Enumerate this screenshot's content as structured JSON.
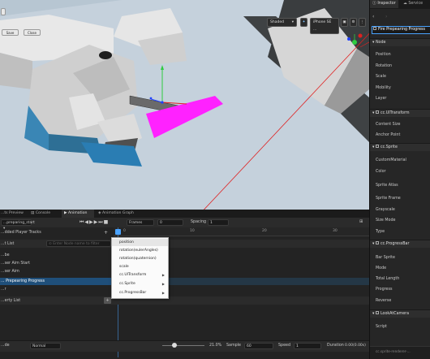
{
  "scene": {
    "buttons": {
      "btn1": "Save",
      "btn2": "Close"
    },
    "shading": "Shaded",
    "device": "iPhone SE ..."
  },
  "bottom": {
    "tabs": [
      "...ts Preview",
      "Console",
      "Animation",
      "Animation Graph"
    ],
    "clip_name": "...preparing_start",
    "frames_label": "Frames",
    "frames_value": "0",
    "spacing_label": "Spacing",
    "spacing_value": "1",
    "ruler": [
      "0",
      "10",
      "20",
      "30"
    ],
    "tracks_header": "...dded Player Tracks",
    "node_list_label": "...t List",
    "filter_placeholder": "Enter Node name to filter",
    "nodes": [
      "...be",
      "...ser Aim Start",
      "...ser Aim",
      "... Prepearing Progress",
      "...r"
    ],
    "property_list_label": "...erty List",
    "mode_label": "...de",
    "wrap_mode": "Normal",
    "zoom": "21.0%",
    "sample_label": "Sample",
    "sample_value": "60",
    "speed_label": "Speed",
    "speed_value": "1",
    "duration_label": "Duration",
    "duration_value": "0.00(0.00s)"
  },
  "context_menu": {
    "items": [
      {
        "label": "position",
        "submenu": false
      },
      {
        "label": "rotation(eulerAngles)",
        "submenu": false
      },
      {
        "label": "rotation(quaternion)",
        "submenu": false
      },
      {
        "label": "scale",
        "submenu": false
      },
      {
        "label": "cc.UITransform",
        "submenu": true
      },
      {
        "label": "cc.Sprite",
        "submenu": true
      },
      {
        "label": "cc.ProgressBar",
        "submenu": true
      }
    ]
  },
  "inspector": {
    "tabs": [
      "Inspector",
      "Service"
    ],
    "node_name": "Fire Prepearing Progress",
    "node_section": "Node",
    "node_props": [
      "Position",
      "Rotation",
      "Scale",
      "Mobility",
      "Layer"
    ],
    "uitransform_section": "cc.UITransform",
    "uitransform_props": [
      "Content Size",
      "Anchor Point"
    ],
    "sprite_section": "cc.Sprite",
    "sprite_props": [
      "CustomMaterial",
      "Color",
      "Sprite Atlas",
      "Sprite Frame",
      "Grayscale",
      "Size Mode",
      "Type"
    ],
    "progressbar_section": "cc.ProgressBar",
    "progressbar_props": [
      "Bar Sprite",
      "Mode",
      "Total Length",
      "Progress",
      "Reverse"
    ],
    "lookat_section": "LookAtCamera",
    "lookat_props": [
      "Script"
    ],
    "footer": "cc.sprite-renderer-..."
  }
}
